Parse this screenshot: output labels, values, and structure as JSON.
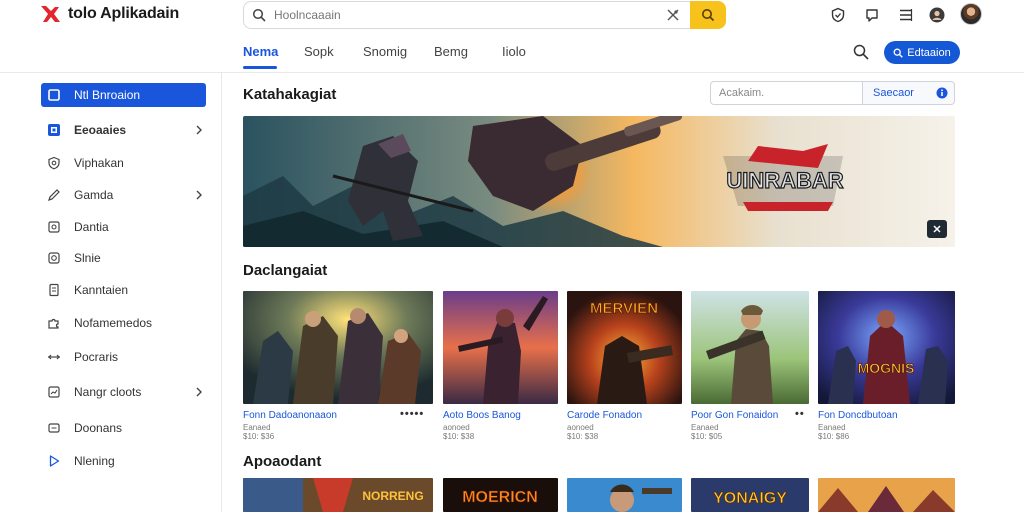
{
  "app": {
    "title": "tolo Aplikadain",
    "brand_color": "#e3262e",
    "accent": "#1a56db",
    "search_button_color": "#f6c21b"
  },
  "header": {
    "search_placeholder": "Hoolncaaain",
    "icons": [
      "search-icon",
      "clear-search-icon",
      "search-go-icon",
      "shield-icon",
      "chat-icon",
      "menu-icon",
      "profile-icon",
      "avatar"
    ]
  },
  "nav": {
    "tabs": [
      {
        "label": "Nema",
        "active": true
      },
      {
        "label": "Sopk",
        "active": false
      },
      {
        "label": "Snomig",
        "active": false
      },
      {
        "label": "Bemg",
        "active": false
      },
      {
        "label": "Iiolo",
        "active": false
      }
    ],
    "primary_button_label": "Edtaaion"
  },
  "sidebar": {
    "items": [
      {
        "label": "Ntl Bnroaion",
        "icon": "square-icon",
        "active": true,
        "chevron": false
      },
      {
        "label": "Eeoaaies",
        "icon": "grid-icon",
        "active": false,
        "chevron": true
      },
      {
        "label": "Viphakan",
        "icon": "shield-outline-icon",
        "active": false,
        "chevron": false
      },
      {
        "label": "Gamda",
        "icon": "pen-icon",
        "active": false,
        "chevron": true
      },
      {
        "label": "Dantia",
        "icon": "image-icon",
        "active": false,
        "chevron": false
      },
      {
        "label": "Slnie",
        "icon": "target-icon",
        "active": false,
        "chevron": false
      },
      {
        "label": "Kanntaien",
        "icon": "document-icon",
        "active": false,
        "chevron": false
      },
      {
        "label": "Nofamemedos",
        "icon": "puzzle-icon",
        "active": false,
        "chevron": false
      },
      {
        "label": "Pocraris",
        "icon": "arrows-icon",
        "active": false,
        "chevron": false
      },
      {
        "label": "Nangr cloots",
        "icon": "chart-icon",
        "active": false,
        "chevron": true
      },
      {
        "label": "Doonans",
        "icon": "folder-icon",
        "active": false,
        "chevron": false
      },
      {
        "label": "Nlening",
        "icon": "play-icon",
        "active": false,
        "chevron": false
      }
    ]
  },
  "main": {
    "section1_title": "Katahakagiat",
    "filter_placeholder": "Acakaim.",
    "filter_button_label": "Saecaor",
    "banner_logo_text": "UINRABAR",
    "section2_title": "Daclangaiat",
    "cards": [
      {
        "title": "Fonn Dadoanonaaon",
        "meta": "Eanaed\n$10: $36",
        "more": true
      },
      {
        "title": "Aoto Boos Banog",
        "meta": "aonoed\n$10: $38",
        "more": false
      },
      {
        "title": "Carode Fonadon",
        "meta": "aonoed\n$10: $38",
        "more": false
      },
      {
        "title": "Poor Gon Fonaidon",
        "meta": "Eanaed\n$10: $05",
        "more": true
      },
      {
        "title": "Fon Doncdbutoan",
        "meta": "Eanaed\n$10: $86",
        "more": false
      }
    ],
    "section3_title": "Apoaodant"
  }
}
